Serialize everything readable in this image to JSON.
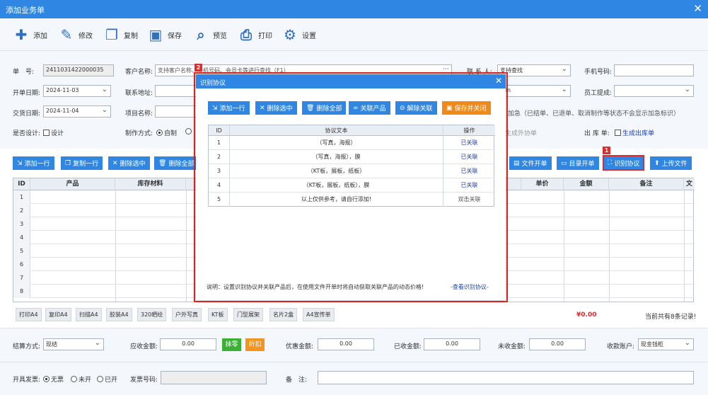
{
  "window": {
    "title": "添加业务单",
    "close": "✕"
  },
  "toolbar": [
    {
      "label": "添加",
      "icon": "add-doc-icon"
    },
    {
      "label": "修改",
      "icon": "edit-icon"
    },
    {
      "label": "复制",
      "icon": "copy-icon"
    },
    {
      "label": "保存",
      "icon": "save-icon"
    },
    {
      "label": "预览",
      "icon": "preview-icon"
    },
    {
      "label": "打印",
      "icon": "print-icon"
    },
    {
      "label": "设置",
      "icon": "gear-icon"
    }
  ],
  "form": {
    "order_no_label": "单　号:",
    "order_no": "2411031422000035",
    "customer_label": "客户名称:",
    "customer_placeholder": "支持客户名称、手机号码、会员卡等进行查找（F1）",
    "customer_more": "···",
    "contact_label": "联 系 人:",
    "contact_value": "支持查找",
    "phone_label": "手机号码:",
    "phone_value": "",
    "open_date_label": "开单日期:",
    "open_date": "2024-11-03",
    "address_label": "联系地址:",
    "address_value": "",
    "admin_value": "min",
    "staff_label": "员工提成:",
    "staff_value": "",
    "deliver_date_label": "交货日期:",
    "deliver_date": "2024-11-04",
    "project_label": "项目名称:",
    "project_value": "",
    "urgent_text": "加急（已结单、已退单、取消制作等状态不会显示加急标识）",
    "design_label": "是否设计:",
    "design_option": "设计",
    "make_label": "制作方式:",
    "make_self": "自制",
    "outsource_text": "生成外协单",
    "outstock_label": "出 库 单:",
    "outstock_option": "生成出库单"
  },
  "actions_left": [
    {
      "label": "添加一行",
      "icon": "add-row-icon"
    },
    {
      "label": "复制一行",
      "icon": "copy-row-icon"
    },
    {
      "label": "删除选中",
      "icon": "delete-x-icon"
    },
    {
      "label": "删除全部",
      "icon": "trash-icon"
    }
  ],
  "actions_right": [
    {
      "label": "文件开单",
      "icon": "file-icon"
    },
    {
      "label": "目录开单",
      "icon": "folder-icon"
    },
    {
      "label": "识别协议",
      "icon": "scan-icon"
    },
    {
      "label": "上传文件",
      "icon": "upload-icon"
    }
  ],
  "grid": {
    "headers": [
      "ID",
      "产品",
      "库存材料",
      "单价",
      "金额",
      "备注",
      "文"
    ],
    "rows": [
      "1",
      "2",
      "3",
      "4",
      "5",
      "6",
      "7",
      "8"
    ]
  },
  "quick_tags": [
    "打印A4",
    "复印A4",
    "扫描A4",
    "胶装A4",
    "320晒绘",
    "户外写真",
    "KT板",
    "门型展架",
    "名片2盒",
    "A4宣传单"
  ],
  "total_amount": "¥0.00",
  "record_count": "当前共有8条记录!",
  "payment": {
    "method_label": "结算方式:",
    "method": "现结",
    "receivable_label": "应收金额:",
    "receivable": "0.00",
    "round_button": "抹零",
    "discount_button": "折扣",
    "discount_amount_label": "优惠金额:",
    "discount_amount": "0.00",
    "received_label": "已收金额:",
    "received": "0.00",
    "unpaid_label": "未收金额:",
    "unpaid": "0.00",
    "account_label": "收款账户:",
    "account": "现金钱柜"
  },
  "invoice": {
    "label": "开具发票:",
    "options": [
      "无票",
      "未开",
      "已开"
    ],
    "number_label": "发票号码:",
    "number": "",
    "remark_label": "备　注:",
    "remark": ""
  },
  "dialog": {
    "title": "识别协议",
    "close": "✕",
    "buttons": [
      {
        "label": "添加一行",
        "icon": "add-row-icon"
      },
      {
        "label": "删除选中",
        "icon": "delete-x-icon"
      },
      {
        "label": "删除全部",
        "icon": "trash-icon"
      },
      {
        "label": "关联产品",
        "icon": "link-icon"
      },
      {
        "label": "解除关联",
        "icon": "unlink-icon"
      },
      {
        "label": "保存并关闭",
        "icon": "save-icon"
      }
    ],
    "table_headers": [
      "ID",
      "协议文本",
      "操作"
    ],
    "rows": [
      {
        "id": "1",
        "text": "（写真，海报）",
        "op": "已关联"
      },
      {
        "id": "2",
        "text": "（写真，海报），膜",
        "op": "已关联"
      },
      {
        "id": "3",
        "text": "（KT板，展板，纸板）",
        "op": "已关联"
      },
      {
        "id": "4",
        "text": "（KT板，展板，纸板），膜",
        "op": "已关联"
      },
      {
        "id": "5",
        "text": "以上仅供参考，请自行添加!",
        "op": "双击关联"
      }
    ],
    "footer_note": "说明：设置识别协议并关联产品后，在使用文件开单时将自动获取关联产品的动态价格!",
    "footer_link": "-查看识别协议-"
  },
  "annotations": {
    "badge1": "1",
    "badge2": "2"
  },
  "colors": {
    "primary": "#2f87e3",
    "highlight": "#e02b2b",
    "save": "#f0891a",
    "green": "#3cb034",
    "orange": "#f39320",
    "link": "#1d3fb0"
  }
}
